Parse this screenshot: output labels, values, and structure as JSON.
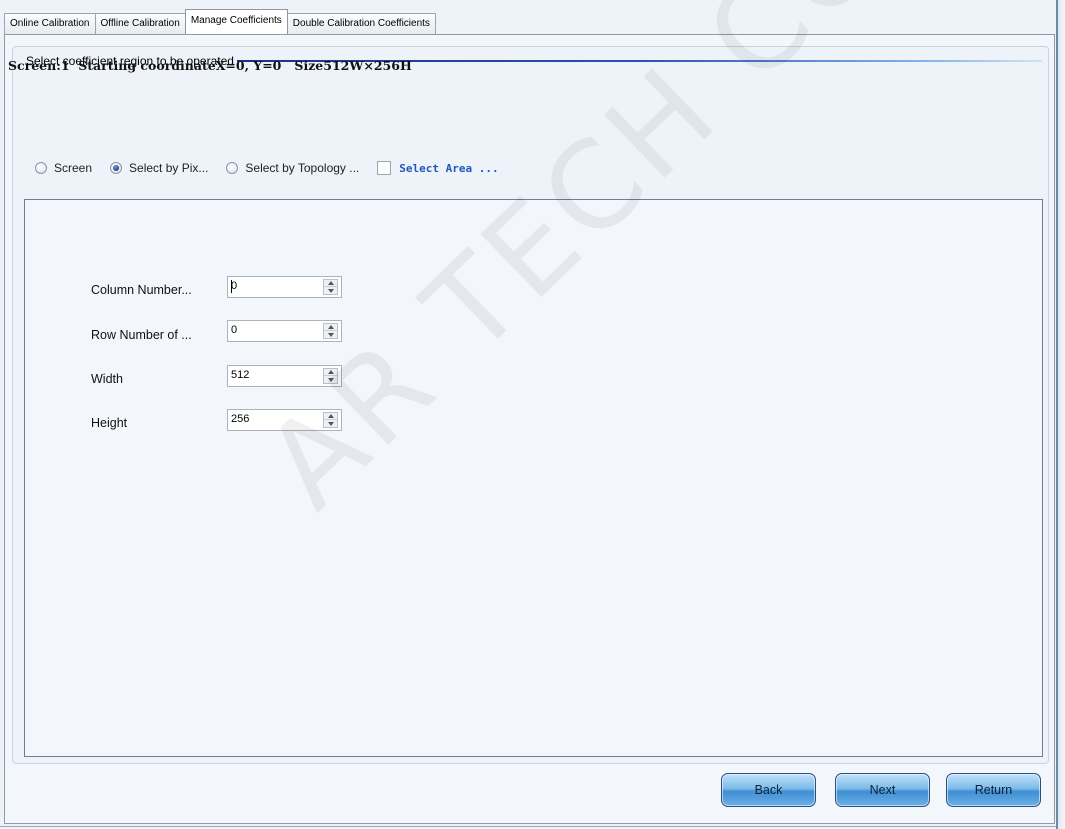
{
  "tabs": [
    {
      "label": "Online Calibration"
    },
    {
      "label": "Offline Calibration"
    },
    {
      "label": "Manage Coefficients",
      "active": true
    },
    {
      "label": "Double Calibration Coefficients"
    }
  ],
  "group": {
    "title": "Select coefficient region to be operated"
  },
  "info": {
    "text": "Screen:1  Starting coordinateX=0, Y=0   Size512W×256H"
  },
  "options": {
    "screen": "Screen",
    "by_pixel": "Select by Pix...",
    "by_topology": "Select by Topology ...",
    "select_area": "Select Area ...",
    "selected": "by_pixel"
  },
  "fields": [
    {
      "label": "Column Number...",
      "value": "0"
    },
    {
      "label": "Row Number of ...",
      "value": "0"
    },
    {
      "label": "Width",
      "value": "512"
    },
    {
      "label": "Height",
      "value": "256"
    }
  ],
  "buttons": {
    "back": "Back",
    "next": "Next",
    "return": "Return"
  },
  "watermark": "AR TECH CO.,LTD.",
  "colors": {
    "accent_line": "#2a51b8",
    "button_blue": "#3f8fd4",
    "select_area_text": "#1f58b8"
  }
}
